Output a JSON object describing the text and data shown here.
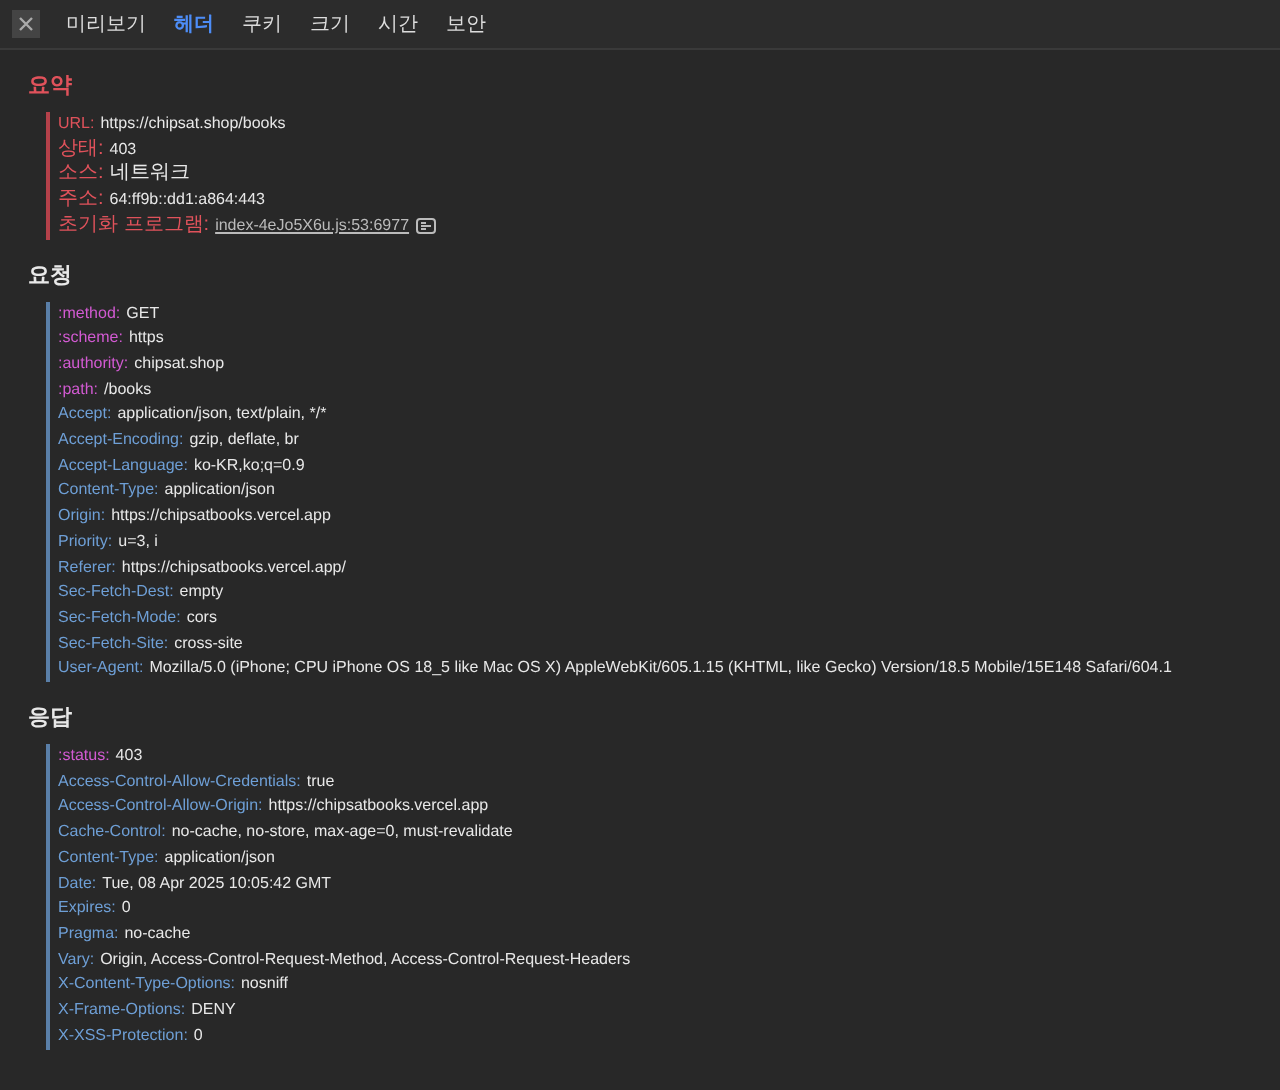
{
  "tabs": [
    {
      "label": "미리보기",
      "selected": false
    },
    {
      "label": "헤더",
      "selected": true
    },
    {
      "label": "쿠키",
      "selected": false
    },
    {
      "label": "크기",
      "selected": false
    },
    {
      "label": "시간",
      "selected": false
    },
    {
      "label": "보안",
      "selected": false
    }
  ],
  "sections": [
    {
      "title": "요약",
      "kind": "summary",
      "rows": [
        {
          "kind": "summary",
          "key": "URL:",
          "value": "https://chipsat.shop/books"
        },
        {
          "kind": "summary",
          "key": "상태:",
          "value": "403"
        },
        {
          "kind": "summary",
          "key": "소스:",
          "value": "네트워크"
        },
        {
          "kind": "summary",
          "key": "주소:",
          "value": "64:ff9b::dd1:a864:443"
        },
        {
          "kind": "link",
          "key": "초기화 프로그램:",
          "value": "index-4eJo5X6u.js:53:6977"
        }
      ]
    },
    {
      "title": "요청",
      "kind": "headers",
      "rows": [
        {
          "kind": "pseudo",
          "key": ":method:",
          "value": "GET"
        },
        {
          "kind": "pseudo",
          "key": ":scheme:",
          "value": "https"
        },
        {
          "kind": "pseudo",
          "key": ":authority:",
          "value": "chipsat.shop"
        },
        {
          "kind": "pseudo",
          "key": ":path:",
          "value": "/books"
        },
        {
          "kind": "header",
          "key": "Accept:",
          "value": "application/json, text/plain, */*"
        },
        {
          "kind": "header",
          "key": "Accept-Encoding:",
          "value": "gzip, deflate, br"
        },
        {
          "kind": "header",
          "key": "Accept-Language:",
          "value": "ko-KR,ko;q=0.9"
        },
        {
          "kind": "header",
          "key": "Content-Type:",
          "value": "application/json"
        },
        {
          "kind": "header",
          "key": "Origin:",
          "value": "https://chipsatbooks.vercel.app"
        },
        {
          "kind": "header",
          "key": "Priority:",
          "value": "u=3, i"
        },
        {
          "kind": "header",
          "key": "Referer:",
          "value": "https://chipsatbooks.vercel.app/"
        },
        {
          "kind": "header",
          "key": "Sec-Fetch-Dest:",
          "value": "empty"
        },
        {
          "kind": "header",
          "key": "Sec-Fetch-Mode:",
          "value": "cors"
        },
        {
          "kind": "header",
          "key": "Sec-Fetch-Site:",
          "value": "cross-site"
        },
        {
          "kind": "header",
          "key": "User-Agent:",
          "value": "Mozilla/5.0 (iPhone; CPU iPhone OS 18_5 like Mac OS X) AppleWebKit/605.1.15 (KHTML, like Gecko) Version/18.5 Mobile/15E148 Safari/604.1"
        }
      ]
    },
    {
      "title": "응답",
      "kind": "headers",
      "rows": [
        {
          "kind": "pseudo",
          "key": ":status:",
          "value": "403"
        },
        {
          "kind": "header",
          "key": "Access-Control-Allow-Credentials:",
          "value": "true"
        },
        {
          "kind": "header",
          "key": "Access-Control-Allow-Origin:",
          "value": "https://chipsatbooks.vercel.app"
        },
        {
          "kind": "header",
          "key": "Cache-Control:",
          "value": "no-cache, no-store, max-age=0, must-revalidate"
        },
        {
          "kind": "header",
          "key": "Content-Type:",
          "value": "application/json"
        },
        {
          "kind": "header",
          "key": "Date:",
          "value": "Tue, 08 Apr 2025 10:05:42 GMT"
        },
        {
          "kind": "header",
          "key": "Expires:",
          "value": "0"
        },
        {
          "kind": "header",
          "key": "Pragma:",
          "value": "no-cache"
        },
        {
          "kind": "header",
          "key": "Vary:",
          "value": "Origin, Access-Control-Request-Method, Access-Control-Request-Headers"
        },
        {
          "kind": "header",
          "key": "X-Content-Type-Options:",
          "value": "nosniff"
        },
        {
          "kind": "header",
          "key": "X-Frame-Options:",
          "value": "DENY"
        },
        {
          "kind": "header",
          "key": "X-XSS-Protection:",
          "value": "0"
        }
      ]
    }
  ]
}
